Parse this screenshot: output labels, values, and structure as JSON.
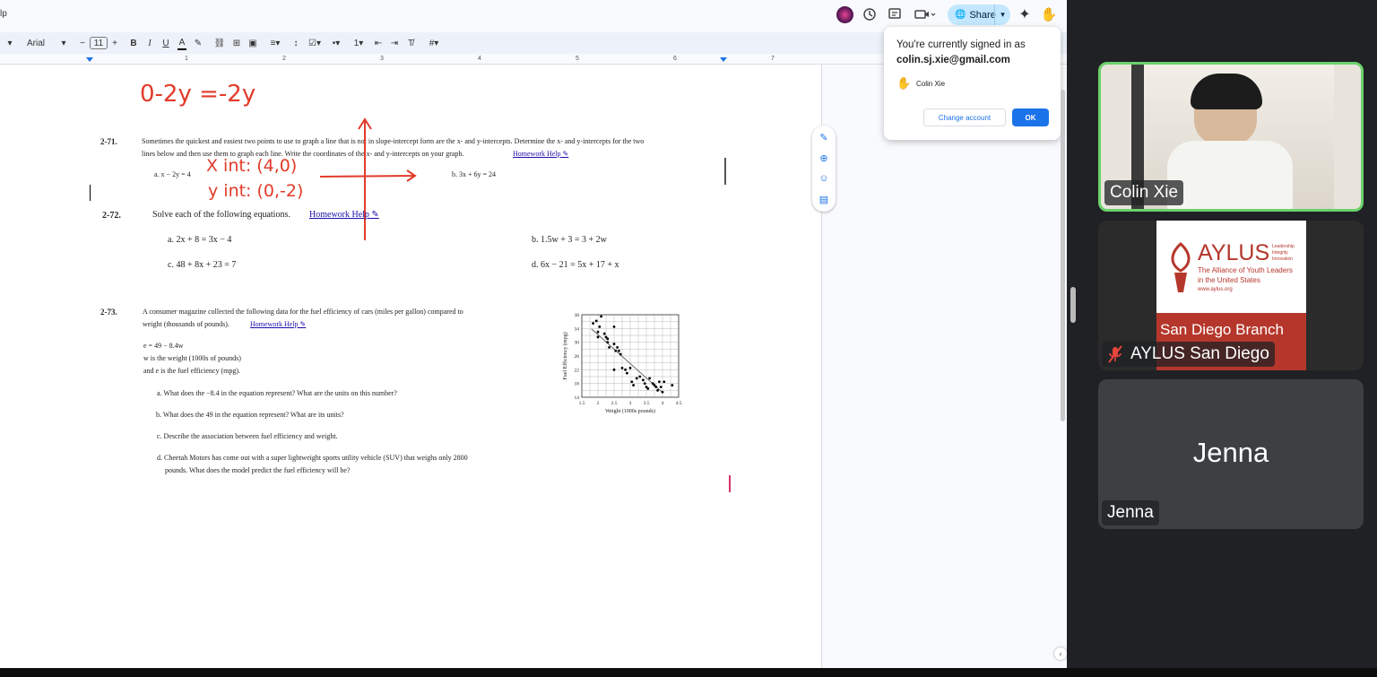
{
  "doc": {
    "title_fragment": "lp",
    "font_name": "Arial",
    "font_size": "11",
    "ruler_numbers": [
      "1",
      "2",
      "3",
      "4",
      "5",
      "6",
      "7"
    ],
    "share_label": "Share",
    "handwriting": {
      "top_equation": "0-2y =-2y",
      "x_int": "X int: (4,0)",
      "y_int": "y int: (0,-2)"
    },
    "p271": {
      "num": "2-71.",
      "line1": "Sometimes the quickest and easiest two points to use to graph a line that is not in slope-intercept form are the x- and y-intercepts. Determine the x- and y-intercepts for the two",
      "line2": "lines below and then use them to graph each line. Write the coordinates of the x- and y-intercepts on your graph.",
      "link": "Homework Help ✎",
      "a": "a. x − 2y = 4",
      "b": "b. 3x + 6y = 24"
    },
    "p272": {
      "num": "2-72.",
      "intro": "Solve each of the following equations.",
      "link": "Homework Help ✎",
      "a": "a.  2x + 8 = 3x − 4",
      "b": "b.  1.5w + 3 = 3 + 2w",
      "c": "c.  48 + 8x + 23 = 7",
      "d": "d.  6x − 21 = 5x + 17 + x"
    },
    "p273": {
      "num": "2-73.",
      "line1": "A consumer magazine collected the following data for the fuel efficiency of cars (miles per gallon) compared to",
      "line2": "weight (thousands of pounds).",
      "link": "Homework Help ✎",
      "eq": "e = 49 − 8.4w",
      "w_def": "w is the weight (1000s of pounds)",
      "e_def": "and e is the fuel efficiency (mpg).",
      "qa": "a. What does the −8.4 in the equation represent? What are the units on this number?",
      "qb": "b. What does the 49 in the equation represent? What are its units?",
      "qc": "c. Describe the association between fuel efficiency and weight.",
      "qd1": "d. Cheetah Motors has come out with a super lightweight sports utility vehicle (SUV) that weighs only 2800",
      "qd2": "pounds. What does the model predict the fuel efficiency will be?"
    },
    "popup": {
      "title": "You're currently signed in as",
      "email": "colin.sj.xie@gmail.com",
      "user": "Colin Xie",
      "change": "Change account",
      "ok": "OK"
    }
  },
  "chart_data": {
    "type": "scatter",
    "xlabel": "Weight (1000s pounds)",
    "ylabel": "Fuel Efficiency (mpg)",
    "xlim": [
      1.5,
      4.5
    ],
    "ylim": [
      14,
      38
    ],
    "x_ticks": [
      "1.5",
      "2",
      "2.5",
      "3",
      "3.5",
      "4",
      "4.5"
    ],
    "y_ticks": [
      "14",
      "18",
      "22",
      "26",
      "30",
      "34",
      "38"
    ],
    "points": [
      [
        1.85,
        35.5
      ],
      [
        1.95,
        36.2
      ],
      [
        2.0,
        33.0
      ],
      [
        2.05,
        34.5
      ],
      [
        2.1,
        37.5
      ],
      [
        2.2,
        32.5
      ],
      [
        2.25,
        31.5
      ],
      [
        2.3,
        31.0
      ],
      [
        2.3,
        30.0
      ],
      [
        2.35,
        28.5
      ],
      [
        2.5,
        34.5
      ],
      [
        2.5,
        29.5
      ],
      [
        2.55,
        27.5
      ],
      [
        2.6,
        28.5
      ],
      [
        2.65,
        27.5
      ],
      [
        2.7,
        26.5
      ],
      [
        2.5,
        22.0
      ],
      [
        2.75,
        22.5
      ],
      [
        2.85,
        22.0
      ],
      [
        2.9,
        21.0
      ],
      [
        3.0,
        22.5
      ],
      [
        3.05,
        18.5
      ],
      [
        3.1,
        17.5
      ],
      [
        3.2,
        19.5
      ],
      [
        3.3,
        20.0
      ],
      [
        3.4,
        19.0
      ],
      [
        3.45,
        18.0
      ],
      [
        3.5,
        17.0
      ],
      [
        3.55,
        16.5
      ],
      [
        3.6,
        19.5
      ],
      [
        3.7,
        18.0
      ],
      [
        3.75,
        17.5
      ],
      [
        3.8,
        17.0
      ],
      [
        3.85,
        16.0
      ],
      [
        3.9,
        18.5
      ],
      [
        3.95,
        17.0
      ],
      [
        4.0,
        15.5
      ],
      [
        4.05,
        18.5
      ],
      [
        4.3,
        17.5
      ],
      [
        2.0,
        31.5
      ]
    ],
    "trendline": {
      "slope": -8.4,
      "intercept": 49
    }
  },
  "participants": [
    {
      "name": "Colin Xie"
    },
    {
      "name": "AYLUS San Diego",
      "logo_title": "AYLUS",
      "logo_tag1": "Leadership",
      "logo_tag2": "Integrity",
      "logo_tag3": "Innovation",
      "logo_sub1": "The Alliance of Youth Leaders",
      "logo_sub2": "in the United States",
      "logo_url": "www.aylus.org",
      "logo_branch": "San Diego Branch"
    },
    {
      "name": "Jenna",
      "initial_label": "Jenna"
    }
  ],
  "colors": {
    "accent": "#1a73e8",
    "handwriting": "#e23b2a",
    "active_speaker": "#6cd16c",
    "aylus_red": "#b5372b"
  }
}
